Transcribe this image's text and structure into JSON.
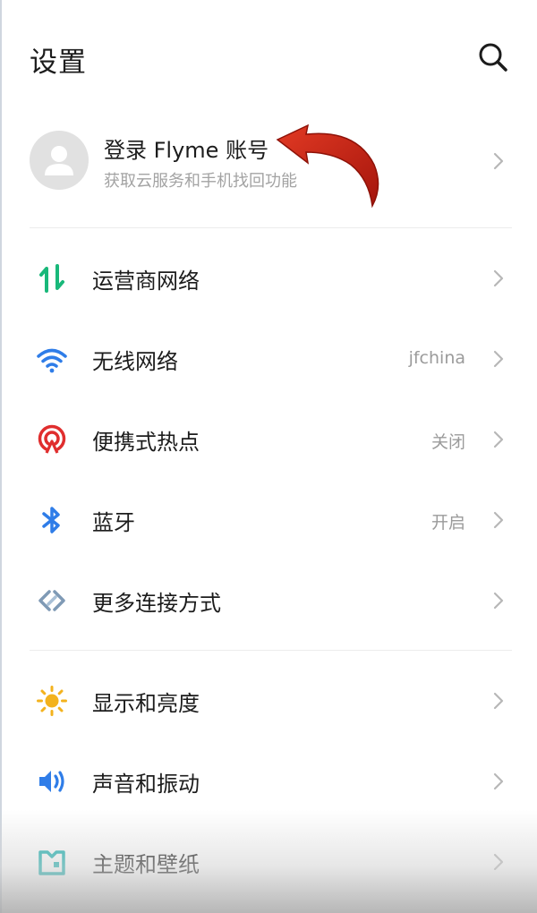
{
  "header": {
    "title": "设置",
    "search_icon": "search-icon"
  },
  "account": {
    "title": "登录 Flyme 账号",
    "subtitle": "获取云服务和手机找回功能",
    "avatar_icon": "avatar-person-icon"
  },
  "sections": [
    {
      "items": [
        {
          "id": "carrier",
          "label": "运营商网络",
          "value": "",
          "icon": "mobile-data-icon",
          "color": "#19b87a"
        },
        {
          "id": "wifi",
          "label": "无线网络",
          "value": "jfchina",
          "icon": "wifi-icon",
          "color": "#2f7de8"
        },
        {
          "id": "hotspot",
          "label": "便携式热点",
          "value": "关闭",
          "icon": "hotspot-icon",
          "color": "#e02e2e"
        },
        {
          "id": "bluetooth",
          "label": "蓝牙",
          "value": "开启",
          "icon": "bluetooth-icon",
          "color": "#2f7de8"
        },
        {
          "id": "more",
          "label": "更多连接方式",
          "value": "",
          "icon": "link-icon",
          "color": "#7f9ab5"
        }
      ]
    },
    {
      "items": [
        {
          "id": "display",
          "label": "显示和亮度",
          "value": "",
          "icon": "brightness-icon",
          "color": "#f3b21d"
        },
        {
          "id": "sound",
          "label": "声音和振动",
          "value": "",
          "icon": "sound-icon",
          "color": "#2f7de8"
        },
        {
          "id": "theme",
          "label": "主题和壁纸",
          "value": "",
          "icon": "theme-icon",
          "color": "#19b1b0"
        }
      ]
    }
  ]
}
